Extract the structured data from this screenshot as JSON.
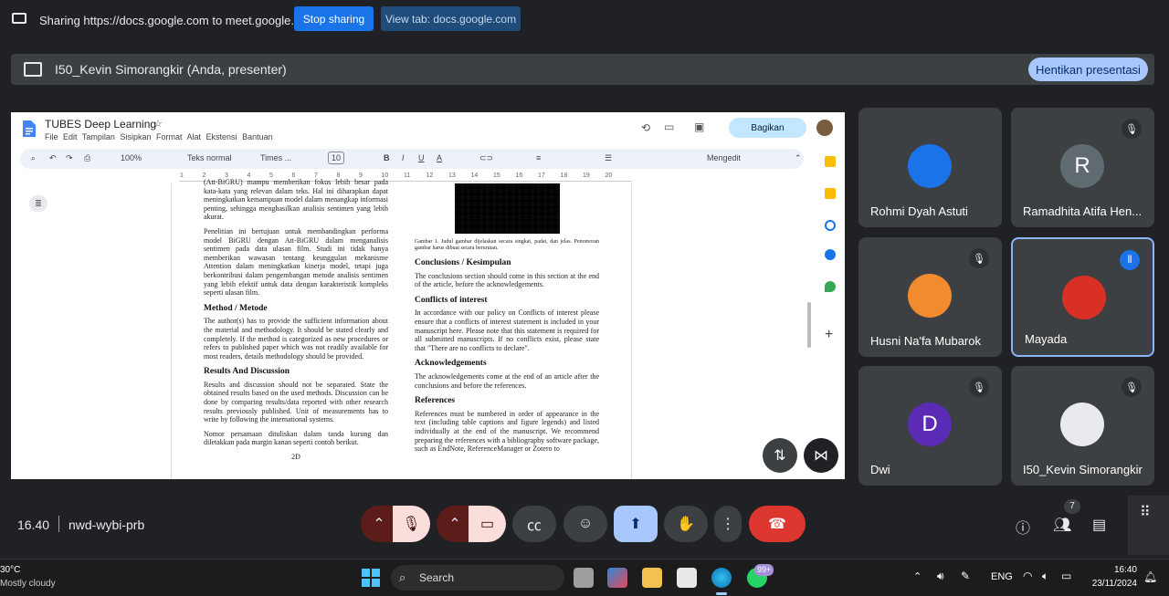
{
  "share_bar": {
    "text": "Sharing https://docs.google.com to meet.google.com",
    "stop_label": "Stop sharing",
    "view_label": "View tab: docs.google.com"
  },
  "presenter_bar": {
    "text": "I50_Kevin Simorangkir (Anda, presenter)",
    "stop_label": "Hentikan presentasi"
  },
  "doc": {
    "title": "TUBES Deep Learning",
    "menus": [
      "File",
      "Edit",
      "Tampilan",
      "Sisipkan",
      "Format",
      "Alat",
      "Ekstensi",
      "Bantuan"
    ],
    "share_label": "Bagikan",
    "zoom": "100%",
    "style": "Teks normal",
    "font": "Times ...",
    "font_size": "10",
    "mode": "Mengedit",
    "ruler": [
      "1",
      "2",
      "3",
      "4",
      "5",
      "6",
      "7",
      "8",
      "9",
      "10",
      "11",
      "12",
      "13",
      "14",
      "15",
      "16",
      "17",
      "18",
      "19",
      "20"
    ],
    "left": {
      "p0": "(Att-BiGRU) mampu memberikan fokus lebih besar pada kata-kata yang relevan dalam teks. Hal ini diharapkan dapat meningkatkan kemampuan model dalam menangkap informasi penting, sehingga menghasilkan analisis sentimen yang lebih akurat.",
      "p1": "Penelitian ini bertujuan untuk membandingkan performa model BiGRU dengan Att-BiGRU dalam menganalisis sentimen pada data ulasan film. Studi ini tidak hanya memberikan wawasan tentang keunggulan mekanisme Attention dalam meningkatkan kinerja model, tetapi juga berkontribusi dalam pengembangan metode analisis sentimen yang lebih efektif untuk data dengan karakteristik kompleks seperti ulasan film.",
      "h_method": "Method / Metode",
      "p_method": "The author(s) has to provide the sufficient information about the material and methodology. It should be stated clearly and completely. If the method is categorized as new procedures or refers to published paper which was not readily available for most readers, details methodology should be provided.",
      "h_results": "Results And Discussion",
      "p_results": "Results and discussion should not be separated. State the obtained results based on the used methods. Discussion can be done by comparing results/data reported with other research results previously published. Unit of measurements has to write by following the international systems.",
      "p_nomor": "Nomor persamaan dituliskan dalam tanda kurung dan diletakkan pada margin kanan seperti contoh berikut.",
      "eq": "2D"
    },
    "right": {
      "caption": "Gambar 1. Judul gambar dijelaskan secara singkat, padat, dan jelas. Penomoran gambar harus dibuat secara berurutan.",
      "h_concl": "Conclusions / Kesimpulan",
      "p_concl": "The conclusions section should come in this section at the end of the article, before the acknowledgements.",
      "h_conf": "Conflicts of interest",
      "p_conf": "In accordance with our policy on Conflicts of interest please ensure that a conflicts of interest statement is included in your manuscript here. Please note that this statement is required for all submitted manuscripts. If no conflicts exist, please state that \"There are no conflicts to declare\".",
      "h_ack": "Acknowledgements",
      "p_ack": "The acknowledgements come at the end of an article after the conclusions and before the references.",
      "h_ref": "References",
      "p_ref": "References must be numbered in order of appearance in the text (including table captions and figure legends) and listed individually at the end of the manuscript. We recommend preparing the references with a bibliography software package, such as EndNote, ReferenceManager or Zotero to"
    }
  },
  "participants": [
    {
      "name": "Rohmi Dyah Astuti",
      "initial": "",
      "color": "#1a73e8",
      "muted": false
    },
    {
      "name": "Ramadhita Atifa Hen...",
      "initial": "R",
      "color": "#5f6b70",
      "muted": true
    },
    {
      "name": "Husni Na'fa Mubarok",
      "initial": "",
      "color": "#f28b30",
      "muted": true
    },
    {
      "name": "Mayada",
      "initial": "",
      "color": "#d93025",
      "muted": false,
      "speaking": true
    },
    {
      "name": "Dwi",
      "initial": "D",
      "color": "#5b2bb5",
      "muted": true
    },
    {
      "name": "I50_Kevin Simorangkir",
      "initial": "",
      "color": "#e8eaed",
      "muted": true
    }
  ],
  "meeting": {
    "time": "16.40",
    "code": "nwd-wybi-prb",
    "participant_count": "7"
  },
  "taskbar": {
    "temp": "30°C",
    "weather": "Mostly cloudy",
    "search": "Search",
    "lang": "ENG",
    "clock": "16:40",
    "date": "23/11/2024",
    "badge": "99+"
  }
}
